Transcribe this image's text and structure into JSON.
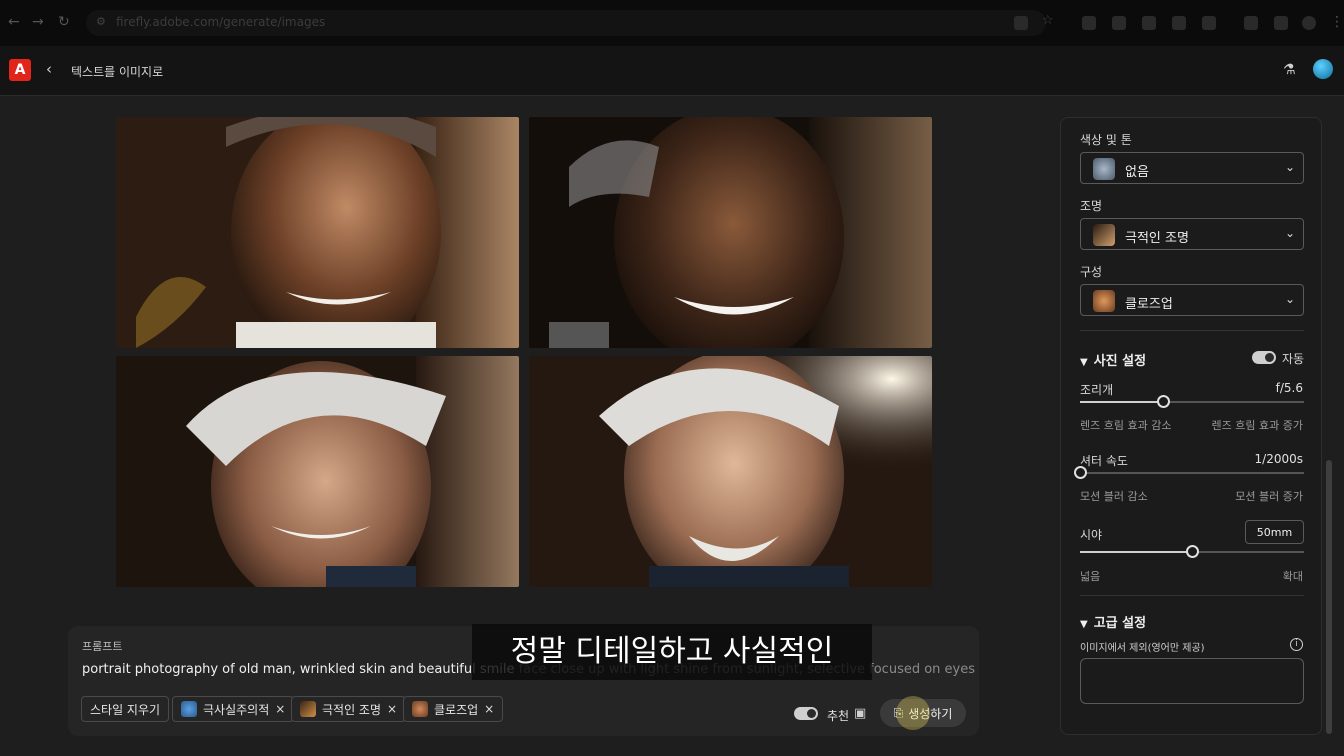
{
  "browser": {
    "url": "firefly.adobe.com/generate/images"
  },
  "app": {
    "logo_letter": "A",
    "title": "텍스트를 이미지로"
  },
  "prompt": {
    "label": "프롬프트",
    "text_main": "portrait photography of old man, wrinkled skin and beautiful smile",
    "text_dim": " face close up with light shine from sunlight, selective focused on eyes",
    "clear_style_label": "스타일 지우기",
    "chips": [
      {
        "label": "극사실주의적",
        "thumb_color": "#3d8ad6"
      },
      {
        "label": "극적인 조명",
        "thumb_color": "#b0722f"
      },
      {
        "label": "클로즈업",
        "thumb_color": "#a2643b"
      }
    ],
    "recommend_label": "추천",
    "generate_label": "생성하기"
  },
  "caption": "정말 디테일하고 사실적인",
  "sidebar": {
    "color_tone": {
      "label": "색상 및 톤",
      "value": "없음"
    },
    "lighting": {
      "label": "조명",
      "value": "극적인 조명"
    },
    "composition": {
      "label": "구성",
      "value": "클로즈업"
    },
    "photo_settings": {
      "title": "사진 설정",
      "auto_label": "자동",
      "aperture": {
        "label": "조리개",
        "value": "f/5.6",
        "min_label": "렌즈 흐림 효과 감소",
        "max_label": "렌즈 흐림 효과 증가",
        "level": 0.37
      },
      "shutter": {
        "label": "셔터 속도",
        "value": "1/2000s",
        "min_label": "모션 블러 감소",
        "max_label": "모션 블러 증가",
        "level": 0.0
      },
      "fov": {
        "label": "시야",
        "value": "50mm",
        "min_label": "넓음",
        "max_label": "확대",
        "level": 0.5
      }
    },
    "advanced": {
      "title": "고급 설정",
      "exclude_label": "이미지에서 제외(영어만 제공)"
    }
  },
  "colors": {
    "accent": "#e1251b",
    "background": "#1e1e1e"
  }
}
